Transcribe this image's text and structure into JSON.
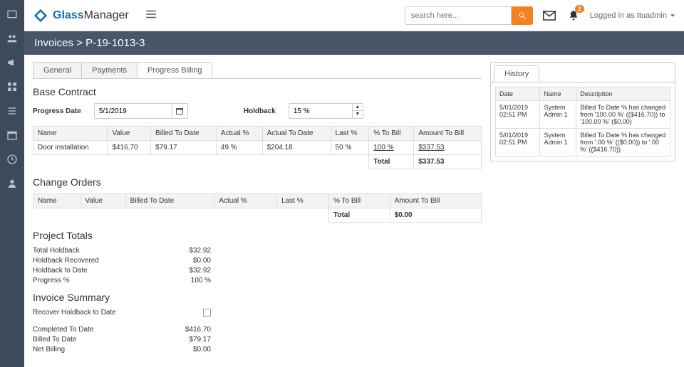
{
  "header": {
    "logo_bold": "Glass",
    "logo_rest": "Manager",
    "search_placeholder": "search here...",
    "notification_count": "2",
    "login_text": "Logged in as ttuadmin"
  },
  "breadcrumb": "Invoices > P-19-1013-3",
  "tabs": {
    "general": "General",
    "payments": "Payments",
    "progress": "Progress Billing"
  },
  "base_contract": {
    "title": "Base Contract",
    "progress_date_label": "Progress Date",
    "progress_date_value": "5/1/2019",
    "holdback_label": "Holdback",
    "holdback_value": "15 %",
    "cols": {
      "name": "Name",
      "value": "Value",
      "billed_to_date": "Billed To Date",
      "actual_pct": "Actual %",
      "actual_to_date": "Actual To Date",
      "last_pct": "Last %",
      "pct_to_bill": "% To Bill",
      "amount_to_bill": "Amount To Bill"
    },
    "row": {
      "name": "Door installation",
      "value": "$416.70",
      "billed_to_date": "$79.17",
      "actual_pct": "49 %",
      "actual_to_date": "$204.18",
      "last_pct": "50 %",
      "pct_to_bill": "100 %",
      "amount_to_bill": "$337.53"
    },
    "total_label": "Total",
    "total_value": "$337.53"
  },
  "change_orders": {
    "title": "Change Orders",
    "cols": {
      "name": "Name",
      "value": "Value",
      "billed_to_date": "Billed To Date",
      "actual_pct": "Actual %",
      "last_pct": "Last %",
      "pct_to_bill": "% To Bill",
      "amount_to_bill": "Amount To Bill"
    },
    "total_label": "Total",
    "total_value": "$0.00"
  },
  "project_totals": {
    "title": "Project Totals",
    "items": {
      "total_holdback_label": "Total Holdback",
      "total_holdback_value": "$32.92",
      "holdback_recovered_label": "Holdback Recovered",
      "holdback_recovered_value": "$0.00",
      "holdback_to_date_label": "Holdback to Date",
      "holdback_to_date_value": "$32.92",
      "progress_pct_label": "Progress %",
      "progress_pct_value": "100 %"
    }
  },
  "invoice_summary": {
    "title": "Invoice Summary",
    "items": {
      "recover_holdback_label": "Recover Holdback to Date",
      "completed_to_date_label": "Completed To Date",
      "completed_to_date_value": "$416.70",
      "billed_to_date_label": "Billed To Date",
      "billed_to_date_value": "$79.17",
      "net_billing_label": "Net Billing",
      "net_billing_value": "$0.00"
    }
  },
  "history": {
    "tab": "History",
    "cols": {
      "date": "Date",
      "name": "Name",
      "description": "Description"
    },
    "rows": [
      {
        "date": "5/01/2019 02:51 PM",
        "name": "System Admin 1",
        "desc": "Billed To Date % has changed from '100.00 %' (($416.70)) to '100.00 %' ($0.00)"
      },
      {
        "date": "5/01/2019 02:51 PM",
        "name": "System Admin 1",
        "desc": "Billed To Date % has changed from '.00 %' (($0.00)) to '.00 %' (($416.70))"
      }
    ]
  }
}
